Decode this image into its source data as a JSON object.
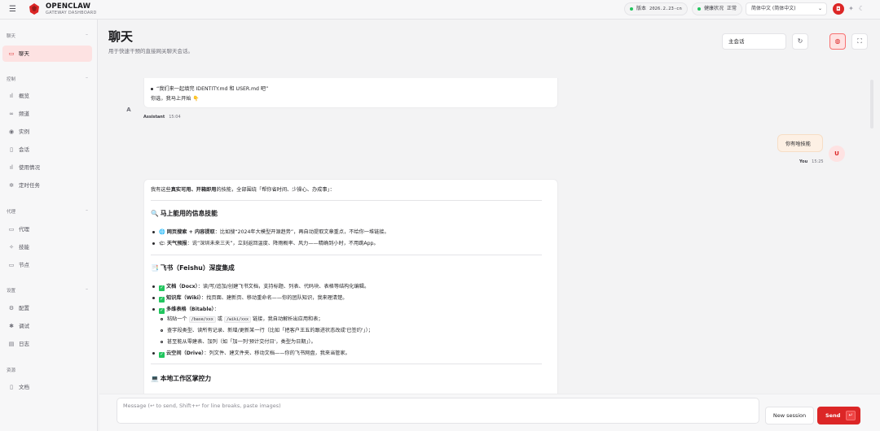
{
  "topbar": {
    "brand": "OPENCLAW",
    "brand_sub": "GATEWAY DASHBOARD",
    "version_label": "版本",
    "version_value": "2026.2.23-cn",
    "health_label": "健康状况",
    "health_value": "正常",
    "language": "简体中文 (简体中文)"
  },
  "sidebar": {
    "sections": {
      "chat": "聊天",
      "control": "控制",
      "agent": "代理",
      "settings": "设置",
      "resources": "资源"
    },
    "items": {
      "chat": "聊天",
      "overview": "概览",
      "channels": "频道",
      "instances": "实例",
      "sessions": "会话",
      "usage": "使用情况",
      "cron": "定时任务",
      "agents": "代理",
      "skills": "技能",
      "nodes": "节点",
      "config": "配置",
      "debug": "调试",
      "logs": "日志",
      "docs": "文档"
    }
  },
  "header": {
    "title": "聊天",
    "subtitle": "用于快速干预的直接网关聊天会话。",
    "session": "主会话"
  },
  "messages": {
    "m1": {
      "line1": "“我们来一起填完 IDENTITY.md 和 USER.md 吧”",
      "line2": "你选，我马上开始",
      "line2_emoji": "👇",
      "avatar": "A",
      "sender": "Assistant",
      "time": "15:04"
    },
    "m2": {
      "text": "你有啥技能",
      "avatar": "U",
      "sender": "You",
      "time": "15:25"
    },
    "m3": {
      "intro_a": "我有这些",
      "intro_b": "真实可用、开箱即用",
      "intro_c": "的技能，全部围绕「帮你省时间、少操心、办成事」：",
      "h1_emoji": "🔍",
      "h1": "马上能用的信息技能",
      "s1_emoji": "🌐",
      "s1_bold": "网页搜索 + 内容提取",
      "s1_rest": "：比如搜“2024年大模型开源趋势”，再自动提取文章重点，不给你一堆链接。",
      "s2_emoji": "🌤",
      "s2_bold": "天气预报",
      "s2_rest": "：说“深圳未来三天”，立刻返回温度、降雨概率、风力——精确到小时，不用跳App。",
      "h2_emoji": "📑",
      "h2": "飞书（Feishu）深度集成",
      "f1_bold": "文档（Docx）",
      "f1_rest": "：读/写/追加/创建飞书文档，支持标题、列表、代码块、表格等结构化编辑。",
      "f2_bold": "知识库（Wiki）",
      "f2_rest": "：找页面、建新页、移动重命名——你的团队知识，我来理清楚。",
      "f3_bold": "多维表格（Bitable）",
      "f3_rest": "：",
      "f3a_pre": "粘贴一个",
      "f3a_code1": "/base/xxx",
      "f3a_mid": "或",
      "f3a_code2": "/wiki/xxx",
      "f3a_post": "链接，我自动解析出应用和表；",
      "f3b": "查字段类型、读所有记录、新增/更新某一行（比如「把客户王五的跟进状态改成'已签约'」）；",
      "f3c": "甚至能从零建表、加列（如「加一列'预计交付日'，类型为日期」）。",
      "f4_bold": "云空间（Drive）",
      "f4_rest": "：列文件、建文件夹、移动文档——你的飞书网盘，我来当管家。",
      "check": "✓",
      "h3_emoji": "💻",
      "h3": "本地工作区掌控力"
    }
  },
  "composer": {
    "placeholder": "Message (↩ to send, Shift+↩ for line breaks, paste images)",
    "new_session": "New session",
    "send": "Send",
    "send_kbd": "↵"
  }
}
